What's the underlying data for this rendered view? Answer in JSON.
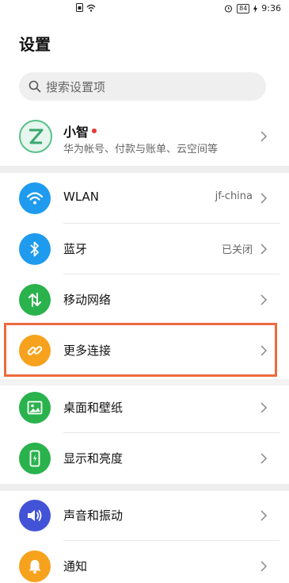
{
  "status_bar": {
    "battery": "84",
    "time": "9:36"
  },
  "page": {
    "title": "设置"
  },
  "search": {
    "placeholder": "搜索设置项"
  },
  "account": {
    "name": "小智",
    "subtitle": "华为帐号、付款与账单、云空间等"
  },
  "rows": [
    {
      "label": "WLAN",
      "value": "jf-china",
      "icon": "wifi-icon",
      "color": "#1e9bef"
    },
    {
      "label": "蓝牙",
      "value": "已关闭",
      "icon": "bluetooth-icon",
      "color": "#1e9bef"
    },
    {
      "label": "移动网络",
      "value": "",
      "icon": "mobile-data-icon",
      "color": "#2ab24d"
    },
    {
      "label": "更多连接",
      "value": "",
      "icon": "link-icon",
      "color": "#f6a21d"
    },
    {
      "label": "桌面和壁纸",
      "value": "",
      "icon": "image-icon",
      "color": "#2ab24d"
    },
    {
      "label": "显示和亮度",
      "value": "",
      "icon": "display-icon",
      "color": "#2ab24d"
    },
    {
      "label": "声音和振动",
      "value": "",
      "icon": "sound-icon",
      "color": "#4353d8"
    },
    {
      "label": "通知",
      "value": "",
      "icon": "bell-icon",
      "color": "#f6a21d"
    }
  ],
  "highlight_color": "#ee6a3e"
}
